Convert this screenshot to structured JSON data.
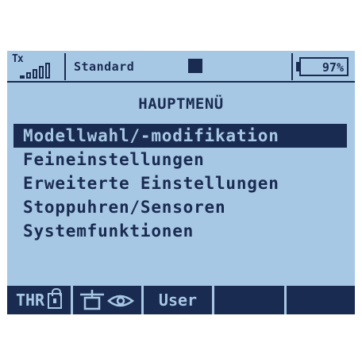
{
  "status": {
    "tx_label": "Tx",
    "signal_bars": 5,
    "signal_filled": 1,
    "model_name": "Standard",
    "battery_text": "97%"
  },
  "menu": {
    "title": "HAUPTMENÜ",
    "items": [
      {
        "label": "Modellwahl/-modifikation",
        "selected": true
      },
      {
        "label": "Feineinstellungen",
        "selected": false
      },
      {
        "label": "Erweiterte Einstellungen",
        "selected": false
      },
      {
        "label": "Stoppuhren/Sensoren",
        "selected": false
      },
      {
        "label": "Systemfunktionen",
        "selected": false
      }
    ]
  },
  "softkeys": {
    "thr_label": "THR",
    "user_label": "User"
  },
  "colors": {
    "screen_bg": "#a7c8e4",
    "ink": "#1a2b52"
  },
  "icons": {
    "lock": "lock-icon",
    "servo": "servo-icon",
    "eye": "eye-icon",
    "signal": "signal-bars-icon",
    "battery": "battery-icon"
  }
}
